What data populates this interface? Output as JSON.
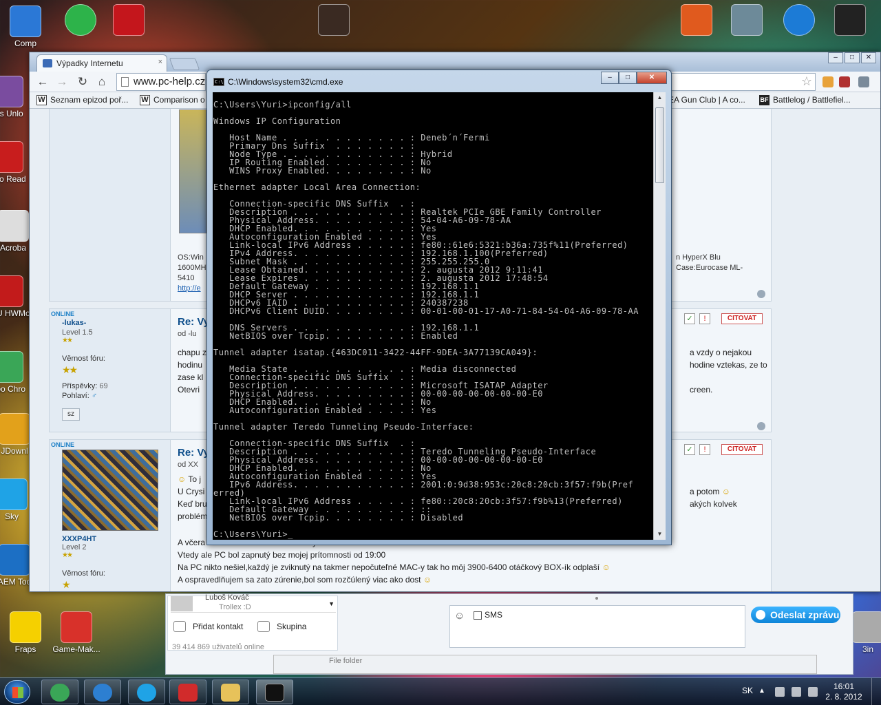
{
  "desktop": {
    "icons": [
      {
        "label": "Comp",
        "color": "#2b78d6"
      },
      {
        "label": "Dis Unlo",
        "color": "#7a4c9f"
      },
      {
        "label": "Ado Read",
        "color": "#c81d1d"
      },
      {
        "label": "Acroba",
        "color": "#dddddd"
      },
      {
        "label": "CPU HWMo",
        "color": "#c21b1b"
      },
      {
        "label": "Goo Chro",
        "color": "#3aa657"
      },
      {
        "label": "JDownl",
        "color": "#e2a11b"
      },
      {
        "label": "Sky",
        "color": "#1fa3e6"
      },
      {
        "label": "DAEM Tools",
        "color": "#1c6fc4"
      },
      {
        "label": "Fraps",
        "color": "#f5d000"
      },
      {
        "label": "Game-Mak...",
        "color": "#d8312a"
      },
      {
        "label": "3in",
        "color": "#aaaaaa"
      }
    ],
    "top_icons": [
      {
        "name": "green-circle-icon",
        "color": "#2db34a"
      },
      {
        "name": "rog-cpuz-icon",
        "color": "#c4161c"
      },
      {
        "name": "mafia-ii-icon",
        "color": "#3a2a22"
      },
      {
        "name": "racing-game-icon",
        "color": "#e05a1e"
      },
      {
        "name": "crysis-2-icon",
        "color": "#6d8a99"
      },
      {
        "name": "eye-icon",
        "color": "#1c7bd6"
      },
      {
        "name": "d3-icon",
        "color": "#222222"
      }
    ]
  },
  "browser": {
    "tab_title": "Výpadky Internetu",
    "tab_close": "×",
    "url": "www.pc-help.cz",
    "bookmarks": [
      {
        "icon": "W",
        "label": "Seznam epizod poř..."
      },
      {
        "icon": "W",
        "label": "Comparison o"
      },
      {
        "icon": "",
        "label": "EA Gun Club | A co..."
      },
      {
        "icon": "BF",
        "label": "Battlelog / Battlefiel..."
      }
    ],
    "win_buttons": [
      "–",
      "□",
      "✕"
    ]
  },
  "forum": {
    "sig_partial": [
      "OS:Win",
      "1600MH",
      "5410",
      "http://e"
    ],
    "sig_right": [
      "n HyperX Blu",
      "Case:Eurocase ML-"
    ],
    "post1": {
      "online": "ONLINE",
      "username": "-lukas-",
      "level": "Level 1.5",
      "stars": "★★",
      "loyalty_label": "Věrnost fóru:",
      "loyalty_stars": "★★",
      "posts_label": "Příspěvky:",
      "posts_value": "69",
      "gender_label": "Pohlaví:",
      "gender_value": "♂",
      "sz_button": "sz",
      "title": "Re: Vy",
      "by": "od -lu",
      "lines": [
        "chapu z",
        "hodinu",
        "zase kl",
        "Otevri"
      ],
      "right_lines": [
        "a vzdy o nejakou",
        "hodine vztekas, ze to",
        "",
        "creen."
      ],
      "citovat": "CITOVAT"
    },
    "post2": {
      "online": "ONLINE",
      "username": "XXXP4HT",
      "level": "Level 2",
      "stars": "★★",
      "loyalty_label": "Věrnost fóru:",
      "loyalty_stars": "★",
      "title": "Re: Vy",
      "by": "od XX",
      "lines": [
        "To j",
        "U Crysi",
        "Keď bru",
        "problém"
      ],
      "right_lines": [
        "a potom",
        "akých kolvek"
      ],
      "citovat": "CITOVAT",
      "body": [
        "A včera o cca 22:00 mi to robilo každých 5-6minút",
        "Vtedy ale PC bol zapnutý bez mojej prítomnosti od 19:00",
        "Na PC nikto nešiel,každý je zviknutý na takmer nepočuteľné MAC-y tak ho môj 3900-6400 otáčkový BOX-ík odplaší",
        "A ospravedlňujem sa zato zúrenie,bol som rozčúlený viac ako dost"
      ]
    }
  },
  "chat": {
    "contact_name": "Luboš Kováč",
    "contact_status": "Trollex :D",
    "add_contact": "Přidat kontakt",
    "group": "Skupina",
    "users_online": "39 414 869 uživatelů online",
    "sms_label": "SMS",
    "send_button": "Odeslat zprávu",
    "folder_partial": "File folder"
  },
  "cmd": {
    "title": "C:\\Windows\\system32\\cmd.exe",
    "icon_text": "C:\\",
    "win_buttons": [
      "–",
      "□",
      "✕"
    ],
    "output": "C:\\Users\\Yuri>ipconfig/all\n\nWindows IP Configuration\n\n   Host Name . . . . . . . . . . . . : Deneb´n´Fermi\n   Primary Dns Suffix  . . . . . . . :\n   Node Type . . . . . . . . . . . . : Hybrid\n   IP Routing Enabled. . . . . . . . : No\n   WINS Proxy Enabled. . . . . . . . : No\n\nEthernet adapter Local Area Connection:\n\n   Connection-specific DNS Suffix  . :\n   Description . . . . . . . . . . . : Realtek PCIe GBE Family Controller\n   Physical Address. . . . . . . . . : 54-04-A6-09-78-AA\n   DHCP Enabled. . . . . . . . . . . : Yes\n   Autoconfiguration Enabled . . . . : Yes\n   Link-local IPv6 Address . . . . . : fe80::61e6:5321:b36a:735f%11(Preferred)\n   IPv4 Address. . . . . . . . . . . : 192.168.1.100(Preferred)\n   Subnet Mask . . . . . . . . . . . : 255.255.255.0\n   Lease Obtained. . . . . . . . . . : 2. augusta 2012 9:11:41\n   Lease Expires . . . . . . . . . . : 2. augusta 2012 17:48:54\n   Default Gateway . . . . . . . . . : 192.168.1.1\n   DHCP Server . . . . . . . . . . . : 192.168.1.1\n   DHCPv6 IAID . . . . . . . . . . . : 240387238\n   DHCPv6 Client DUID. . . . . . . . : 00-01-00-01-17-A0-71-84-54-04-A6-09-78-AA\n\n   DNS Servers . . . . . . . . . . . : 192.168.1.1\n   NetBIOS over Tcpip. . . . . . . . : Enabled\n\nTunnel adapter isatap.{463DC011-3422-44FF-9DEA-3A77139CA049}:\n\n   Media State . . . . . . . . . . . : Media disconnected\n   Connection-specific DNS Suffix  . :\n   Description . . . . . . . . . . . : Microsoft ISATAP Adapter\n   Physical Address. . . . . . . . . : 00-00-00-00-00-00-00-E0\n   DHCP Enabled. . . . . . . . . . . : No\n   Autoconfiguration Enabled . . . . : Yes\n\nTunnel adapter Teredo Tunneling Pseudo-Interface:\n\n   Connection-specific DNS Suffix  . :\n   Description . . . . . . . . . . . : Teredo Tunneling Pseudo-Interface\n   Physical Address. . . . . . . . . : 00-00-00-00-00-00-00-E0\n   DHCP Enabled. . . . . . . . . . . : No\n   Autoconfiguration Enabled . . . . : Yes\n   IPv6 Address. . . . . . . . . . . : 2001:0:9d38:953c:20c8:20cb:3f57:f9b(Pref\nerred)\n   Link-local IPv6 Address . . . . . : fe80::20c8:20cb:3f57:f9b%13(Preferred)\n   Default Gateway . . . . . . . . . : ::\n   NetBIOS over Tcpip. . . . . . . . : Disabled\n\nC:\\Users\\Yuri>_"
  },
  "taskbar": {
    "apps": [
      {
        "name": "chrome",
        "color": "#3aa657"
      },
      {
        "name": "itunes",
        "color": "#2d7fd1"
      },
      {
        "name": "skype",
        "color": "#1fa3e6"
      },
      {
        "name": "flashget",
        "color": "#d12b2b"
      },
      {
        "name": "explorer",
        "color": "#e7c25a"
      },
      {
        "name": "cmd",
        "color": "#111111"
      }
    ],
    "language": "SK",
    "time": "16:01",
    "date": "2. 8. 2012"
  }
}
